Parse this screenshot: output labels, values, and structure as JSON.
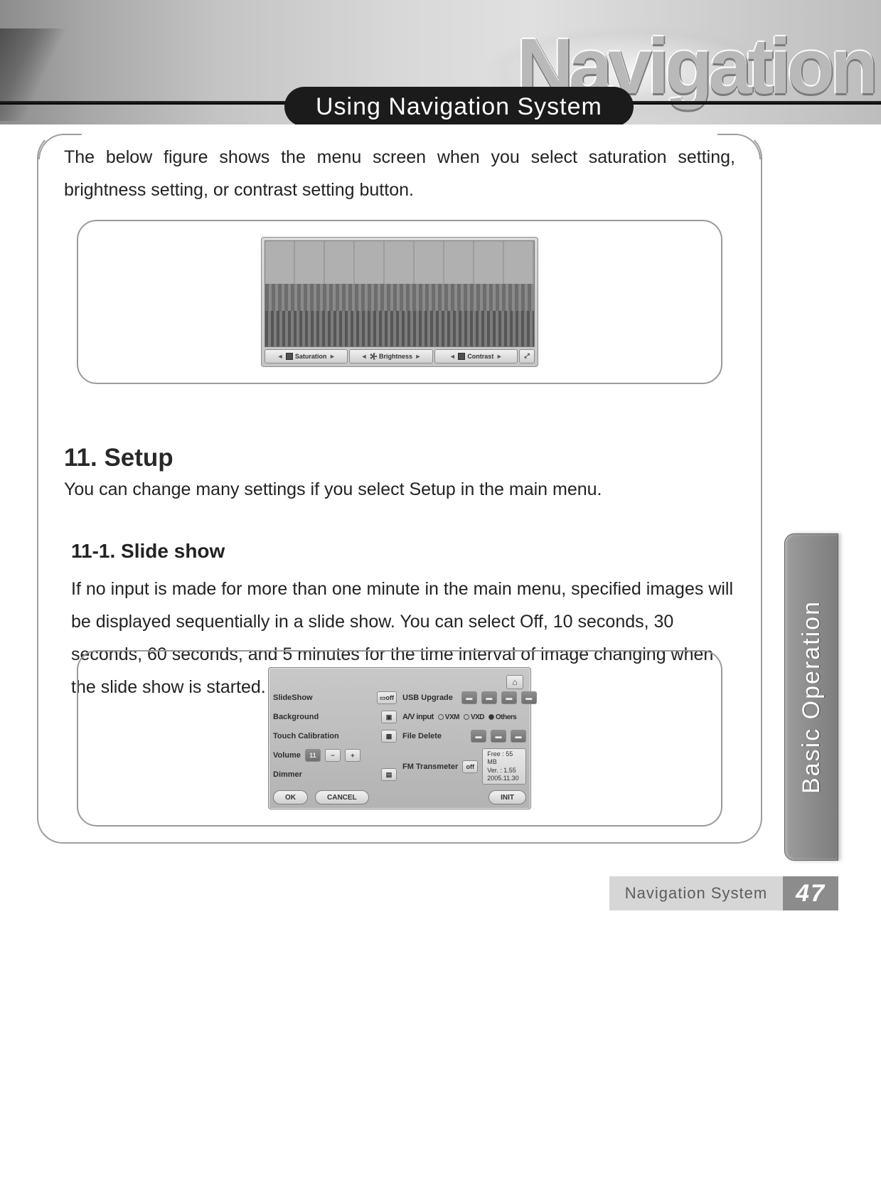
{
  "header": {
    "wordmark": "Navigation",
    "chapter_title": "Using Navigation System"
  },
  "intro_text": "The below figure shows the menu screen when you select saturation setting, brightness setting, or contrast setting button.",
  "figure1": {
    "controls": {
      "saturation": "Saturation",
      "brightness": "Brightness",
      "contrast": "Contrast"
    }
  },
  "section": {
    "heading": "11. Setup",
    "subtext": "You can change many settings if you select Setup in the main menu."
  },
  "subsection": {
    "heading": "11-1. Slide show",
    "body": "If no input is made for more than one minute in the main menu, specified images will be displayed sequentially in a slide show. You can select Off, 10 seconds, 30 seconds, 60 seconds, and 5 minutes for the time interval of image changing when the slide show is started."
  },
  "figure2": {
    "left": {
      "slideshow_label": "SlideShow",
      "slideshow_value": "off",
      "background_label": "Background",
      "touchcal_label": "Touch Calibration",
      "volume_label": "Volume",
      "volume_value": "11",
      "dimmer_label": "Dimmer"
    },
    "right": {
      "usb_label": "USB Upgrade",
      "av_label": "A/V input",
      "av_opt1": "VXM",
      "av_opt2": "VXD",
      "av_opt3": "Others",
      "filedel_label": "File Delete",
      "fm_label": "FM Transmeter",
      "fm_value": "off",
      "status_free": "Free : 55 MB",
      "status_ver": "Ver. : 1.55",
      "status_date": "2005.11.30"
    },
    "buttons": {
      "ok": "OK",
      "cancel": "CANCEL",
      "init": "INIT"
    }
  },
  "side_tab": "Basic Operation",
  "footer": {
    "label": "Navigation System",
    "page": "47"
  }
}
